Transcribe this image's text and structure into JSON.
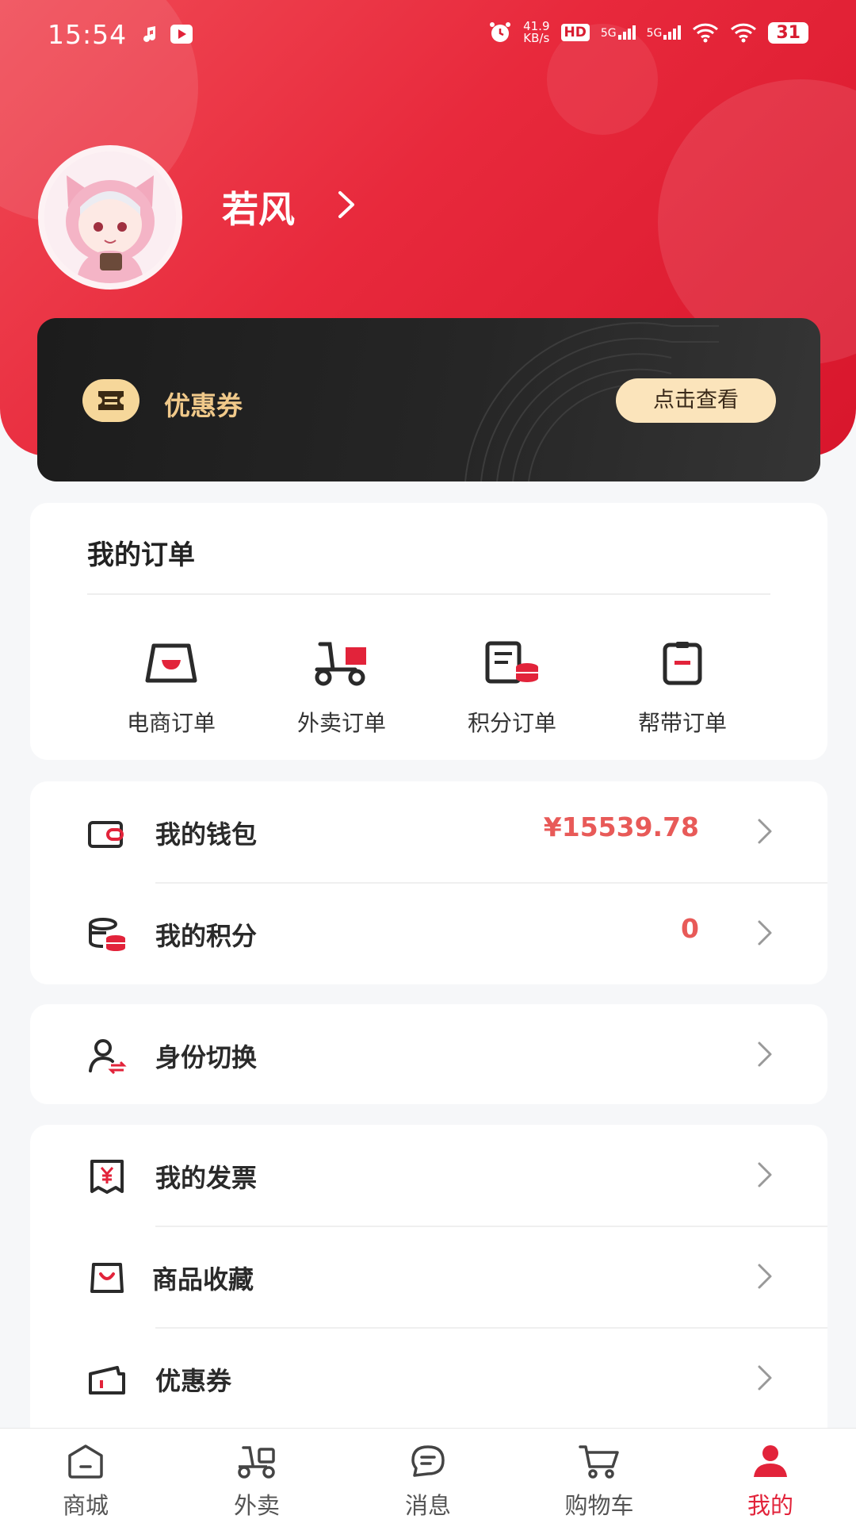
{
  "status_bar": {
    "time": "15:54",
    "net_speed_value": "41.9",
    "net_speed_unit": "KB/s",
    "hd_label": "HD",
    "signal1_label": "5G",
    "signal2_label": "5G",
    "battery": "31"
  },
  "profile": {
    "username": "若风"
  },
  "coupon_banner": {
    "title": "优惠券",
    "button_label": "点击查看"
  },
  "orders": {
    "title": "我的订单",
    "items": [
      {
        "label": "电商订单",
        "icon": "shop-bag-icon"
      },
      {
        "label": "外卖订单",
        "icon": "delivery-scooter-icon"
      },
      {
        "label": "积分订单",
        "icon": "points-receipt-icon"
      },
      {
        "label": "帮带订单",
        "icon": "clipboard-icon"
      }
    ]
  },
  "wallet_card": {
    "wallet_label": "我的钱包",
    "wallet_value": "¥15539.78",
    "points_label": "我的积分",
    "points_value": "0"
  },
  "identity_card": {
    "switch_label": "身份切换"
  },
  "misc_card": {
    "invoice_label": "我的发票",
    "favorites_label": "商品收藏",
    "coupon_label": "优惠券"
  },
  "bottom_nav": {
    "items": [
      {
        "label": "商城",
        "icon": "mall-icon"
      },
      {
        "label": "外卖",
        "icon": "scooter-icon"
      },
      {
        "label": "消息",
        "icon": "message-icon"
      },
      {
        "label": "购物车",
        "icon": "cart-icon"
      },
      {
        "label": "我的",
        "icon": "user-icon"
      }
    ],
    "active_index": 4
  },
  "colors": {
    "accent": "#e2233a",
    "price": "#e85a58",
    "gold": "#f0c98a"
  }
}
